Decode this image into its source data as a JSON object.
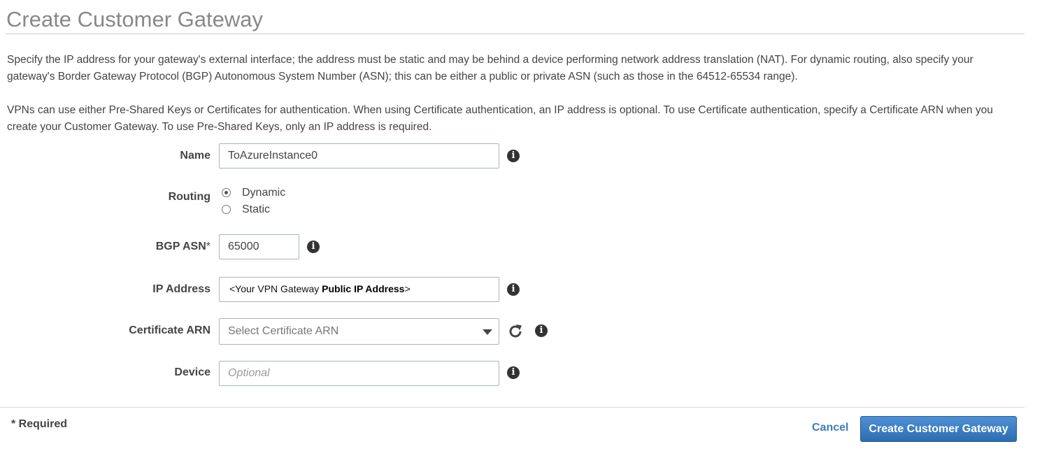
{
  "page": {
    "title": "Create Customer Gateway",
    "intro_1": "Specify the IP address for your gateway's external interface; the address must be static and may be behind a device performing network address translation (NAT). For dynamic routing, also specify your gateway's Border Gateway Protocol (BGP) Autonomous System Number (ASN); this can be either a public or private ASN (such as those in the 64512-65534 range).",
    "intro_2": "VPNs can use either Pre-Shared Keys or Certificates for authentication. When using Certificate authentication, an IP address is optional. To use Certificate authentication, specify a Certificate ARN when you create your Customer Gateway. To use Pre-Shared Keys, only an IP address is required."
  },
  "form": {
    "name": {
      "label": "Name",
      "value": "ToAzureInstance0",
      "icon": "info-icon"
    },
    "routing": {
      "label": "Routing",
      "options": [
        "Dynamic",
        "Static"
      ],
      "selected": "Dynamic"
    },
    "bgp_asn": {
      "label": "BGP ASN",
      "required_mark": "*",
      "value": "65000",
      "icon": "info-icon"
    },
    "ip_address": {
      "label": "IP Address",
      "value_prefix": "<Your VPN Gateway ",
      "value_bold": "Public IP Address",
      "value_suffix": ">",
      "icon": "info-icon"
    },
    "certificate_arn": {
      "label": "Certificate ARN",
      "placeholder": "Select Certificate ARN",
      "refresh_icon": "refresh-icon",
      "icon": "info-icon"
    },
    "device": {
      "label": "Device",
      "placeholder": "Optional",
      "icon": "info-icon"
    }
  },
  "footer": {
    "required_note": "* Required",
    "cancel_label": "Cancel",
    "submit_label": "Create Customer Gateway"
  },
  "colors": {
    "primary_button": "#2e6db1",
    "link": "#3a7cbf",
    "title": "#888888",
    "text": "#444444"
  }
}
